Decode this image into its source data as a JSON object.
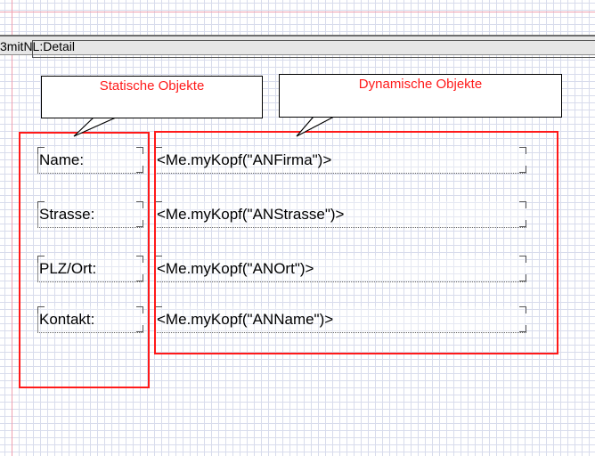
{
  "section": {
    "label": "3mitNL:Detail"
  },
  "header": {
    "partial_text": "h"
  },
  "callouts": {
    "static": "Statische Objekte",
    "dynamic": "Dynamische Objekte"
  },
  "fields": {
    "labels": [
      "Name:",
      "Strasse:",
      "PLZ/Ort:",
      "Kontakt:"
    ],
    "values": [
      "<Me.myKopf(\"ANFirma\")>",
      "<Me.myKopf(\"ANStrasse\")>",
      "<Me.myKopf(\"ANOrt\")>",
      "<Me.myKopf(\"ANName\")>"
    ]
  },
  "colors": {
    "annotation": "#ff1a1a",
    "grid": "#d8dcec",
    "section_bar": "#e6e6e6"
  }
}
